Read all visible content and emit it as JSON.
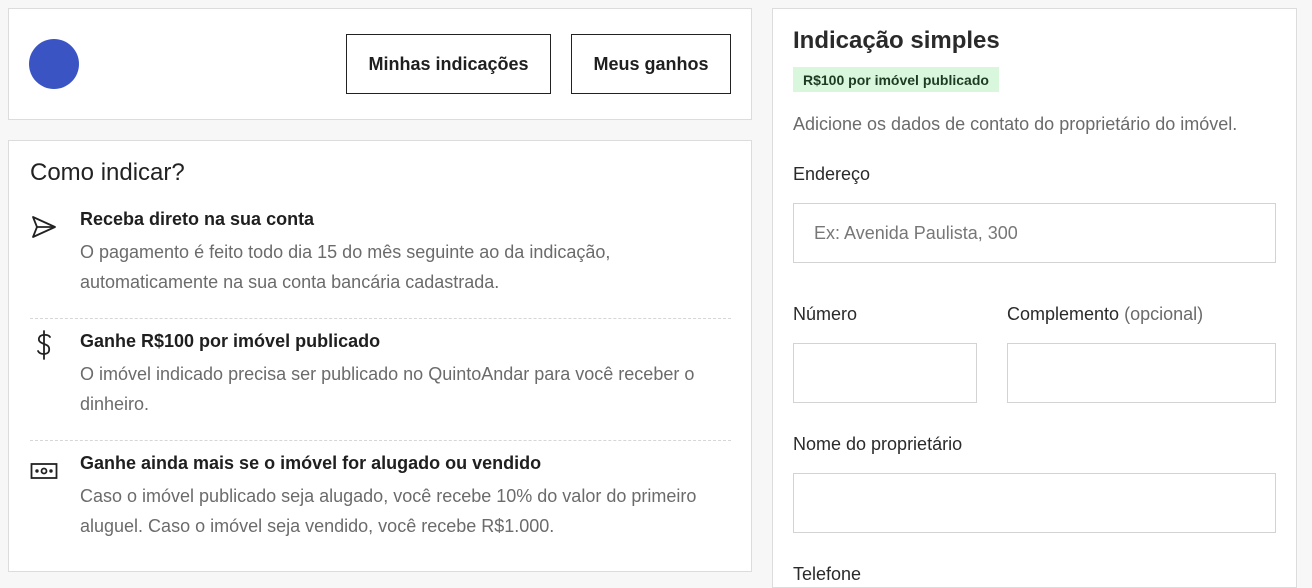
{
  "header": {
    "my_referrals_label": "Minhas indicações",
    "my_earnings_label": "Meus ganhos",
    "avatar_color": "#3b54c4"
  },
  "how": {
    "title": "Como indicar?",
    "steps": [
      {
        "icon": "send-icon",
        "title": "Receba direto na sua conta",
        "desc": "O pagamento é feito todo dia 15 do mês seguinte ao da indicação, automaticamente na sua conta bancária cadastrada."
      },
      {
        "icon": "dollar-icon",
        "title": "Ganhe R$100 por imóvel publicado",
        "desc": "O imóvel indicado precisa ser publicado no QuintoAndar para você receber o dinheiro."
      },
      {
        "icon": "money-bill-icon",
        "title": "Ganhe ainda mais se o imóvel for alugado ou vendido",
        "desc": "Caso o imóvel publicado seja alugado, você recebe 10% do valor do primeiro aluguel. Caso o imóvel seja vendido, você recebe R$1.000."
      }
    ]
  },
  "form": {
    "title": "Indicação simples",
    "badge": "R$100 por imóvel publicado",
    "badge_color": "#d9f7dc",
    "subtitle": "Adicione os dados de contato do proprietário do imóvel.",
    "address_label": "Endereço",
    "address_placeholder": "Ex: Avenida Paulista, 300",
    "number_label": "Número",
    "complement_label": "Complemento",
    "complement_optional": "(opcional)",
    "owner_label": "Nome do proprietário",
    "phone_label": "Telefone"
  }
}
